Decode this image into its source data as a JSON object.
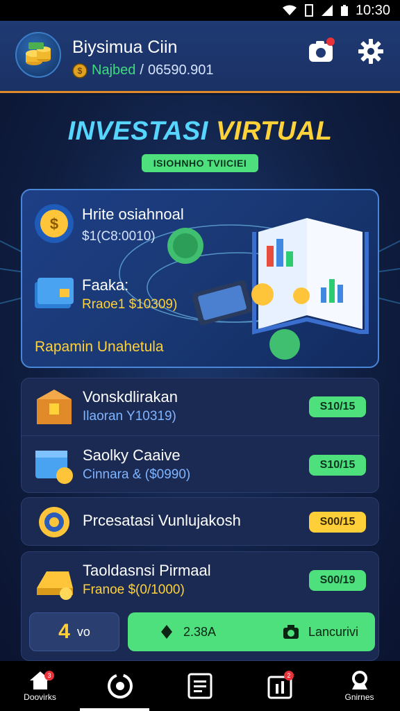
{
  "status": {
    "time": "10:30"
  },
  "header": {
    "app_title": "Biysimua Ciin",
    "badge": "Najbed",
    "separator": "/",
    "balance": "06590.901"
  },
  "main": {
    "title_part1": "INVESTASI",
    "title_part2": "VIRTUAL",
    "tag": "ISIOHNHO TVIICIEI"
  },
  "hero": {
    "item1_label": "Hrite osiahnoal",
    "item1_value": "$1(C8:0010)",
    "item2_label": "Faaka:",
    "item2_value": "Rraoe1 $10309)",
    "footer": "Rapamin Unahetula"
  },
  "rows": [
    {
      "title": "Vonskdlirakan",
      "sub": "Ilaoran Y10319)",
      "pill": "S10/15",
      "pill_color": "#4ee07c"
    },
    {
      "title": "Saolky Caaive",
      "sub": "Cinnara & ($0990)",
      "pill": "S10/15",
      "pill_color": "#4ee07c"
    },
    {
      "title": "Prcesatasi Vunlujakosh",
      "sub": "",
      "pill": "S00/15",
      "pill_color": "#ffcf3a"
    },
    {
      "title": "Taoldasnsi Pirmaal",
      "sub": "Franoe $(0/1000)",
      "pill": "S00/19",
      "pill_color": "#4ee07c"
    }
  ],
  "actions": {
    "left_number": "4",
    "left_label": "vo",
    "right_amount": "2.38A",
    "right_label": "Lancurivi"
  },
  "nav": [
    {
      "label": "Doovirks",
      "icon": "home-icon",
      "badge": "3"
    },
    {
      "label": "",
      "icon": "refresh-icon",
      "badge": ""
    },
    {
      "label": "",
      "icon": "list-icon",
      "badge": ""
    },
    {
      "label": "",
      "icon": "report-icon",
      "badge": "2"
    },
    {
      "label": "Gnirnes",
      "icon": "settings-icon",
      "badge": ""
    }
  ]
}
